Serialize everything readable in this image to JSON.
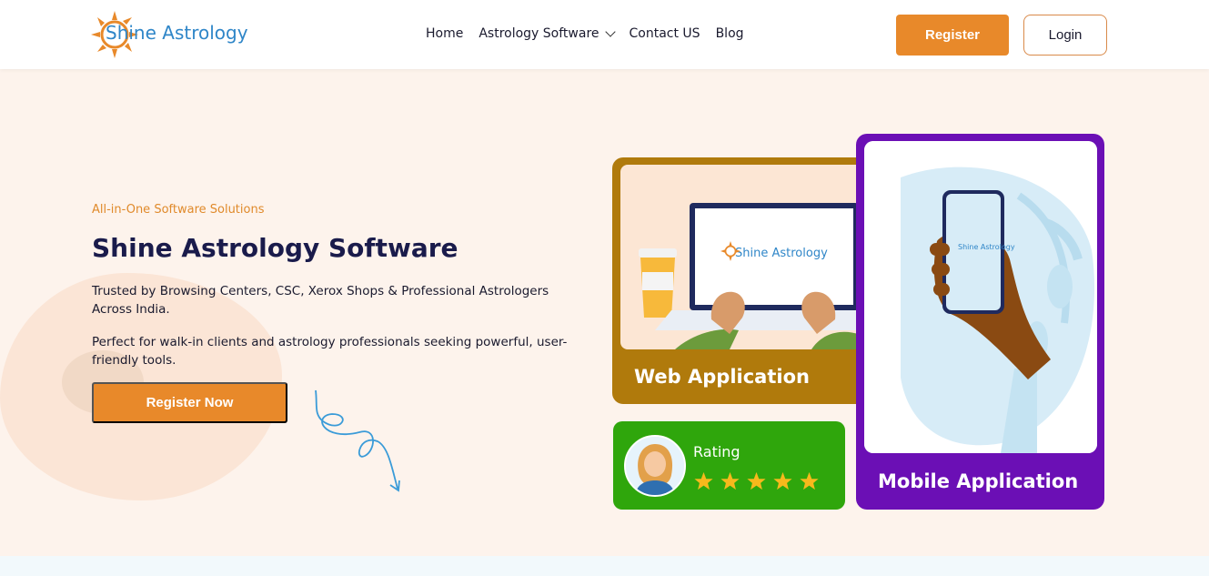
{
  "header": {
    "logo_text": "Shine Astrology",
    "nav": [
      {
        "label": "Home"
      },
      {
        "label": "Astrology Software"
      },
      {
        "label": "Contact US"
      },
      {
        "label": "Blog"
      }
    ],
    "register_label": "Register",
    "login_label": "Login"
  },
  "hero": {
    "eyebrow": "All-in-One Software Solutions",
    "title": "Shine Astrology Software",
    "paragraph1": "Trusted by Browsing Centers, CSC, Xerox Shops & Professional Astrologers Across India.",
    "paragraph2": "Perfect for walk-in clients and astrology professionals seeking powerful, user-friendly tools.",
    "cta_label": "Register Now"
  },
  "cards": {
    "web": {
      "label": "Web Application",
      "screen_logo": "Shine Astrology"
    },
    "mobile": {
      "label": "Mobile Application",
      "screen_logo": "Shine Astrology"
    },
    "rating": {
      "label": "Rating",
      "stars": 5
    }
  },
  "colors": {
    "accent": "#e8892a",
    "brand_blue": "#2f86c8",
    "web_card": "#b07a0c",
    "mobile_card": "#6b0fb5",
    "rating_card": "#2fa60c",
    "star": "#f6b91c"
  },
  "icons": [
    "sun-logo-icon",
    "chevron-down-icon",
    "star-icon"
  ]
}
